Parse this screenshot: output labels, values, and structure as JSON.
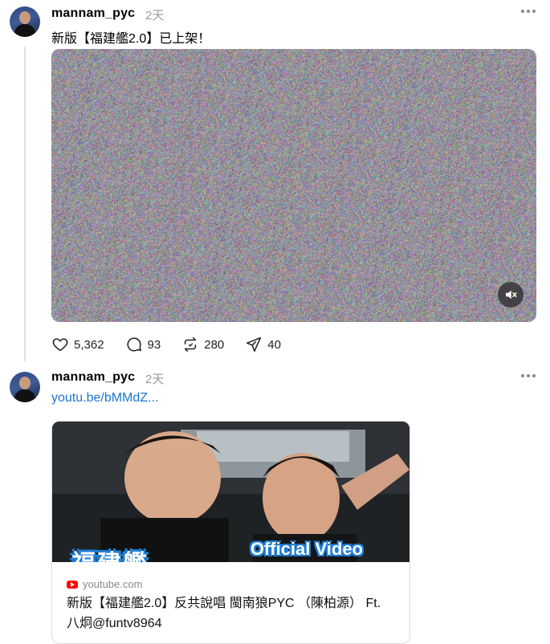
{
  "posts": [
    {
      "username": "mannam_pyc",
      "time": "2天",
      "caption": "新版【福建艦2.0】已上架！",
      "stats": {
        "likes": "5,362",
        "comments": "93",
        "reposts": "280",
        "shares": "40"
      }
    },
    {
      "username": "mannam_pyc",
      "time": "2天",
      "link_text": "youtu.be/bMMdZ...",
      "card": {
        "domain": "youtube.com",
        "title": "新版【福建艦2.0】反共說唱 閩南狼PYC （陳柏源） Ft. 八炯@funtv8964",
        "overlay_text": "Official Video",
        "overlay_big": "福建艦"
      }
    }
  ],
  "icons": [
    "heart-icon",
    "comment-icon",
    "repost-icon",
    "share-icon",
    "mute-icon",
    "more-icon",
    "youtube-icon"
  ]
}
